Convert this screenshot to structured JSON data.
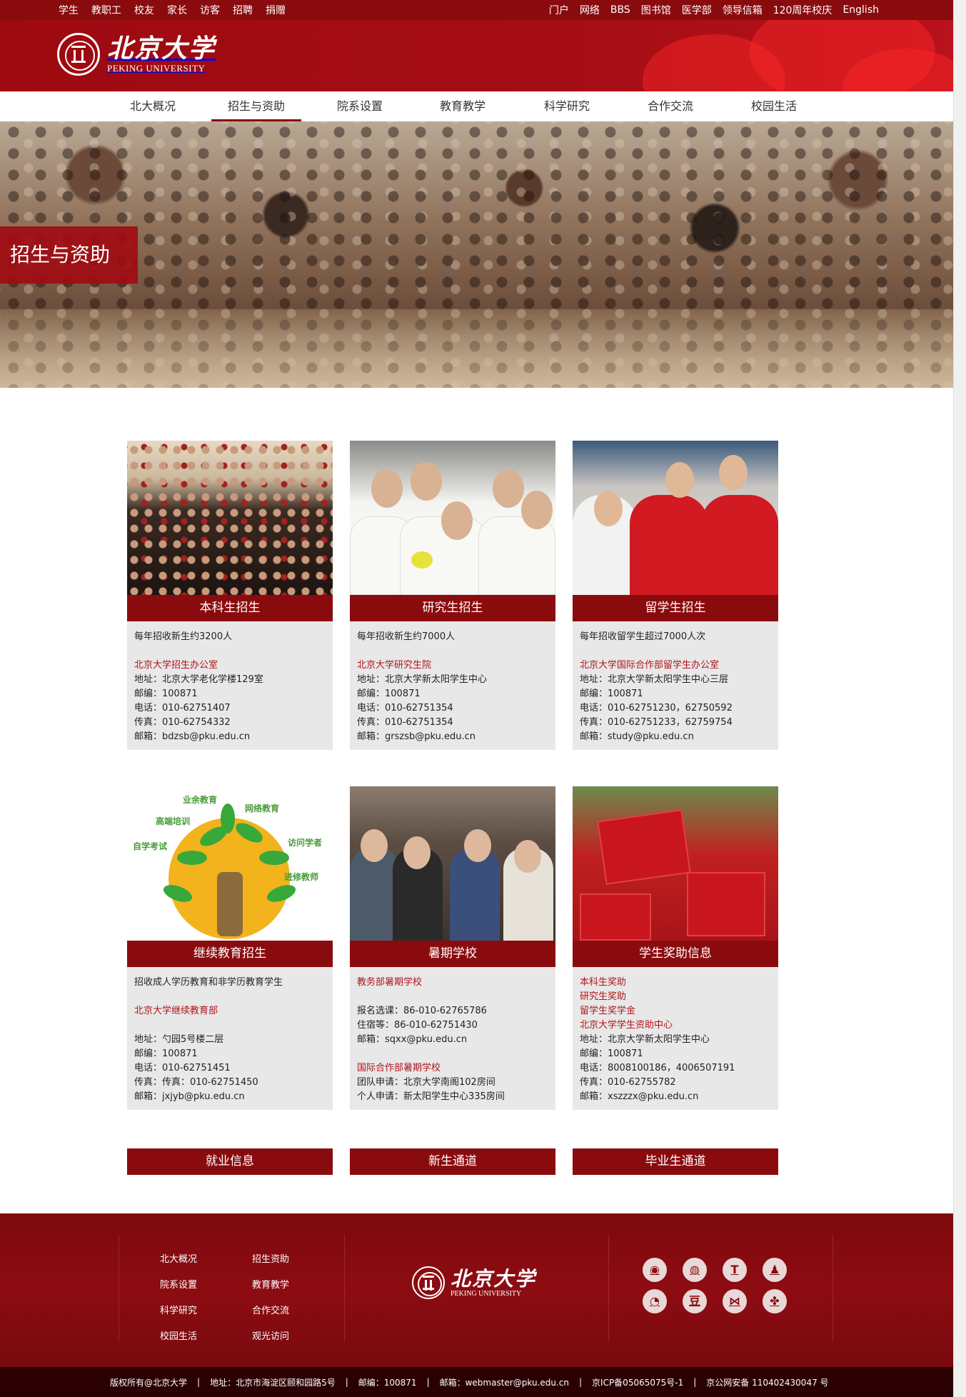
{
  "topbar": {
    "left_links": [
      "学生",
      "教职工",
      "校友",
      "家长",
      "访客",
      "招聘",
      "捐赠"
    ],
    "right_links": [
      "门户",
      "网络",
      "BBS",
      "图书馆",
      "医学部",
      "领导信箱",
      "120周年校庆",
      "English"
    ]
  },
  "header": {
    "logo_cn": "北京大学",
    "logo_en": "PEKING UNIVERSITY"
  },
  "nav": {
    "items": [
      "北大概况",
      "招生与资助",
      "院系设置",
      "教育教学",
      "科学研究",
      "合作交流",
      "校园生活"
    ],
    "active_index": 1
  },
  "banner": {
    "label": "招生与资助"
  },
  "cards": [
    {
      "title": "本科生招生",
      "summary": "每年招收新生约3200人",
      "office": "北京大学招生办公室",
      "lines": [
        "地址：北京大学老化学楼129室",
        "邮编：100871",
        "电话：010-62751407",
        "传真：010-62754332",
        "邮箱：bdzsb@pku.edu.cn"
      ]
    },
    {
      "title": "研究生招生",
      "summary": "每年招收新生约7000人",
      "office": "北京大学研究生院",
      "lines": [
        "地址：北京大学新太阳学生中心",
        "邮编：100871",
        "电话：010-62751354",
        "传真：010-62751354",
        "邮箱：grszsb@pku.edu.cn"
      ]
    },
    {
      "title": "留学生招生",
      "summary": "每年招收留学生超过7000人次",
      "office": "北京大学国际合作部留学生办公室",
      "lines": [
        "地址：北京大学新太阳学生中心三层",
        "邮编：100871",
        "电话：010-62751230，62750592",
        "传真：010-62751233，62759754",
        "邮箱：study@pku.edu.cn"
      ]
    },
    {
      "title": "继续教育招生",
      "summary": "招收成人学历教育和非学历教育学生",
      "office": "北京大学继续教育部",
      "lines": [
        "地址：勺园5号楼二层",
        "邮编：100871",
        "电话：010-62751451",
        "传真：传真：010-62751450",
        "邮箱：jxjyb@pku.edu.cn"
      ],
      "tree_labels": [
        "业余教育",
        "网络教育",
        "高端培训",
        "访问学者",
        "自学考试",
        "进修教师"
      ]
    },
    {
      "title": "暑期学校",
      "section1_title": "教务部暑期学校",
      "section1_lines": [
        "报名选课：86-010-62765786",
        "住宿等：86-010-62751430",
        "邮箱：sqxx@pku.edu.cn"
      ],
      "section2_title": "国际合作部暑期学校",
      "section2_lines": [
        "团队申请：北京大学南阁102房间",
        "个人申请：新太阳学生中心335房间"
      ]
    },
    {
      "title": "学生奖助信息",
      "red_links": [
        "本科生奖助",
        "研究生奖助",
        "留学生奖学金",
        "北京大学学生资助中心"
      ],
      "lines": [
        "地址：北京大学新太阳学生中心",
        "邮编：100871",
        "电话：8008100186，4006507191",
        "传真：010-62755782",
        "邮箱：xszzzx@pku.edu.cn"
      ]
    }
  ],
  "bottom_buttons": [
    "就业信息",
    "新生通道",
    "毕业生通道"
  ],
  "footer": {
    "links_col1": [
      "北大概况",
      "院系设置",
      "科学研究",
      "校园生活"
    ],
    "links_col2": [
      "招生资助",
      "教育教学",
      "合作交流",
      "观光访问"
    ],
    "logo_cn": "北京大学",
    "logo_en": "PEKING UNIVERSITY",
    "social_icons": [
      "weibo-icon",
      "wechat-icon",
      "tencent-weibo-icon",
      "qq-icon",
      "renren-icon",
      "douban-icon",
      "kaixin-icon",
      "clover-icon"
    ],
    "social_glyphs": [
      "◉",
      "◍",
      "T",
      "♟",
      "◔",
      "豆",
      "⋈",
      "✤"
    ]
  },
  "copyright": {
    "items": [
      "版权所有@北京大学",
      "地址：北京市海淀区颐和园路5号",
      "邮编：100871",
      "邮箱：webmaster@pku.edu.cn",
      "京ICP备05065075号-1",
      "京公网安备 110402430047 号"
    ]
  },
  "colors": {
    "brand_red": "#8a0b0e",
    "link_red": "#b0141b",
    "card_bg": "#e8e8e8"
  }
}
